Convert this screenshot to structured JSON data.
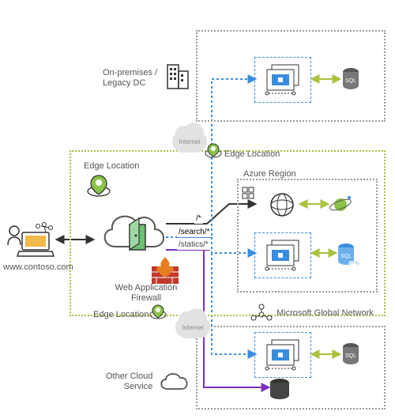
{
  "labels": {
    "client_url": "www.contoso.com",
    "onprem": "On-premises /\nLegacy DC",
    "edge_location_top": "Edge Location",
    "edge_location_left": "Edge Location",
    "edge_location_bottom": "Edge Location",
    "azure_region": "Azure Region",
    "waf": "Web Application\nFirewall",
    "ms_global_network": "Microsoft Global Network",
    "other_cloud": "Other Cloud\nService",
    "internet": "Internet"
  },
  "paths": {
    "p1": "/*",
    "p2": "/search/*",
    "p3": "/statics/*"
  },
  "icons": {
    "client": "laptop-user-icon",
    "building": "building-icon",
    "edge_pin": "location-pin-icon",
    "cloud_door": "cloud-door-icon",
    "firewall": "firewall-icon",
    "vmss": "vm-stack-icon",
    "sql": "sql-database-icon",
    "network": "network-mesh-icon",
    "cosmos": "cosmos-icon",
    "webapp": "webapp-globe-icon",
    "appsvc": "app-service-icon",
    "storage": "storage-icon",
    "cloud": "cloud-outline-icon"
  },
  "colors": {
    "blue": "#3a8dde",
    "green": "#a9c23f",
    "purple": "#7b2fbf",
    "gray": "#9b9b9b",
    "black": "#333333"
  }
}
